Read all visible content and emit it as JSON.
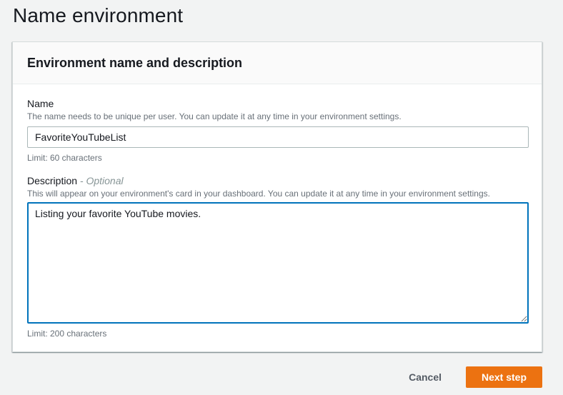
{
  "page": {
    "title": "Name environment"
  },
  "card": {
    "title": "Environment name and description"
  },
  "name_field": {
    "label": "Name",
    "description": "The name needs to be unique per user. You can update it at any time in your environment settings.",
    "value": "FavoriteYouTubeList",
    "constraint": "Limit: 60 characters"
  },
  "description_field": {
    "label": "Description",
    "optional_tag": "- Optional",
    "description": "This will appear on your environment's card in your dashboard. You can update it at any time in your environment settings.",
    "value": "Listing your favorite YouTube movies.",
    "constraint": "Limit: 200 characters"
  },
  "actions": {
    "cancel_label": "Cancel",
    "next_label": "Next step"
  },
  "colors": {
    "primary_button": "#ec7211",
    "focus_border": "#0073bb",
    "background": "#f2f3f3"
  }
}
